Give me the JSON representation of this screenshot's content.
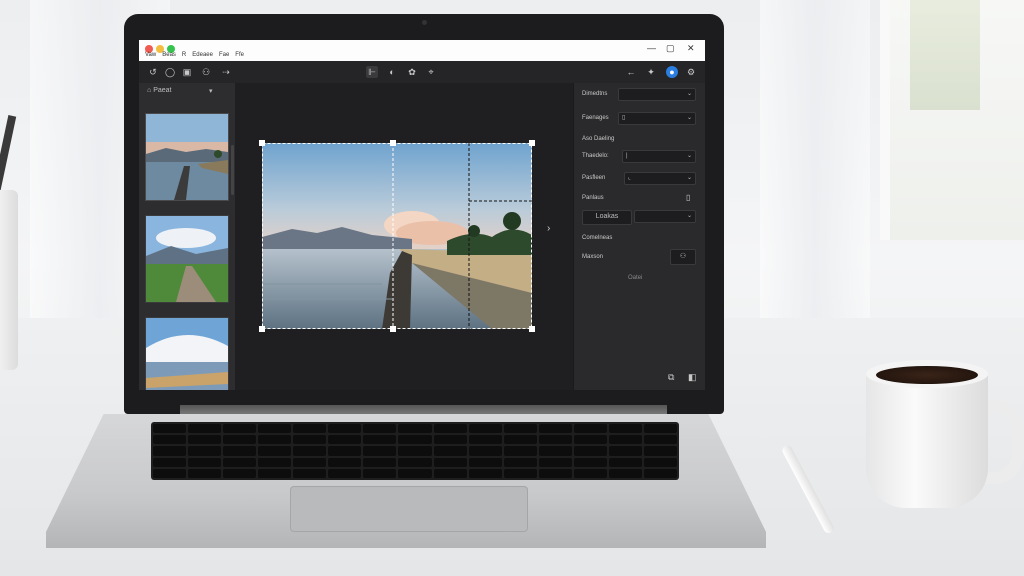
{
  "menu": [
    "Vaw",
    "Beas",
    "R",
    "Edeaee",
    "Fae",
    "Ffe"
  ],
  "toolbar": {
    "icons": [
      "undo-icon",
      "redo-icon",
      "crop-icon",
      "person-icon",
      "arrow-icon",
      "split-icon",
      "adjust-icon",
      "palette-icon",
      "pin-icon",
      "back-icon",
      "puzzle-icon",
      "profile-icon",
      "settings-icon"
    ]
  },
  "left_panel": {
    "title": "Paeat",
    "dropdown": "▾"
  },
  "right_panel": {
    "dimensions_label": "Dimedtns",
    "format_label": "Faenages",
    "section_label": "Aso Daeling",
    "tradeoff_label": "Thaedelo:",
    "pattern_label": "Pasfleen",
    "panel_label": "Panlaus",
    "lookup_button": "Loakas",
    "comments_label": "Comelneas",
    "mason_label": "Maxson",
    "done_label": "Oatei"
  },
  "colors": {
    "accent": "#2a7de1",
    "screen_bg": "#1f1f21",
    "panel_bg": "#2a2a2c"
  }
}
